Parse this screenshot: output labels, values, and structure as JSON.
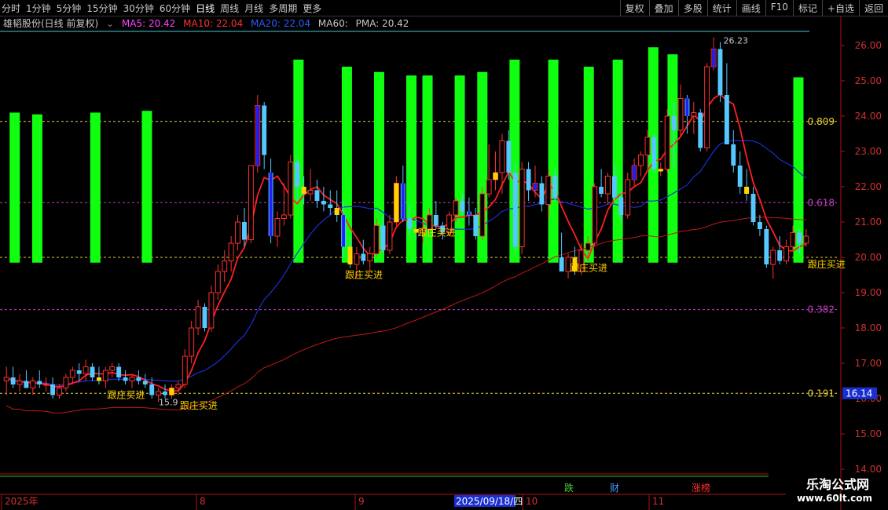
{
  "toolbar": {
    "periods": [
      "分时",
      "1分钟",
      "5分钟",
      "15分钟",
      "30分钟",
      "60分钟",
      "日线",
      "周线",
      "月线",
      "多周期",
      "更多"
    ],
    "active_period": "日线",
    "right_buttons": [
      "复权",
      "叠加",
      "多股",
      "统计",
      "画线",
      "F10",
      "标记",
      "+自选",
      "返回"
    ]
  },
  "info": {
    "title": "雄韬股份(日线 前复权)",
    "ma5": "MA5: 20.42",
    "ma10": "MA10: 22.04",
    "ma20": "MA20: 22.04",
    "ma60": "MA60:",
    "pma": "PMA: 20.42"
  },
  "colors": {
    "up": "#ff3030",
    "down": "#55c8ff",
    "green_bar": "#10ff10",
    "yellow": "#ffd200",
    "blue": "#2020ff",
    "ma_red": "#ff2020",
    "ma_dark_red": "#c01818",
    "ma_blue": "#1a2fd0",
    "fib_yellow": "#e6d23c",
    "fib_magenta": "#c040c0",
    "axis": "#b01010",
    "cyan_line": "#40c8d8"
  },
  "watermark": {
    "line1": "乐淘公式网",
    "line2": "www.60lt.com"
  },
  "chart_data": {
    "type": "candlestick",
    "ylim": [
      14.0,
      26.4
    ],
    "y_ticks": [
      "26.00",
      "25.00",
      "24.00",
      "23.00",
      "22.00",
      "21.00",
      "20.00",
      "19.00",
      "18.00",
      "17.00",
      "16.00",
      "15.00",
      "14.00"
    ],
    "last_price_label": "16.14",
    "fib_levels": [
      {
        "label": "0.809",
        "price": 23.85
      },
      {
        "label": "0.618",
        "price": 21.55
      },
      {
        "label": "",
        "price": 20.0
      },
      {
        "label": "0.382",
        "price": 18.52
      },
      {
        "label": "0.191",
        "price": 16.15
      }
    ],
    "high_label": "26.23",
    "low_label": "15.9",
    "x_labels": [
      "2025年",
      "8",
      "9",
      "2025/09/18/四",
      "10",
      "11"
    ],
    "markers": [
      "跌",
      "财",
      "涨榜"
    ],
    "green_bar_top_prices": [
      24.1,
      24.05,
      24.1,
      24.15,
      25.6,
      25.4,
      25.25,
      25.15,
      25.15,
      25.15,
      25.25,
      25.6,
      25.6,
      25.4,
      25.6,
      25.95,
      25.75,
      25.1
    ],
    "buy_signals": [
      "跟庄买进",
      "跟庄买进",
      "跟庄买进",
      "跟庄买进",
      "跟庄买进",
      "跟庄买进"
    ],
    "candles": [
      {
        "o": 16.5,
        "h": 16.9,
        "l": 16.1,
        "c": 16.6
      },
      {
        "o": 16.6,
        "h": 16.9,
        "l": 16.3,
        "c": 16.4
      },
      {
        "o": 16.4,
        "h": 16.7,
        "l": 16.2,
        "c": 16.5
      },
      {
        "o": 16.5,
        "h": 16.8,
        "l": 16.3,
        "c": 16.3
      },
      {
        "o": 16.3,
        "h": 16.6,
        "l": 16.1,
        "c": 16.5
      },
      {
        "o": 16.5,
        "h": 16.8,
        "l": 16.3,
        "c": 16.4
      },
      {
        "o": 16.4,
        "h": 16.6,
        "l": 16.2,
        "c": 16.4
      },
      {
        "o": 16.4,
        "h": 16.6,
        "l": 16.0,
        "c": 16.1
      },
      {
        "o": 16.1,
        "h": 16.4,
        "l": 16.0,
        "c": 16.3
      },
      {
        "o": 16.3,
        "h": 16.7,
        "l": 16.2,
        "c": 16.6
      },
      {
        "o": 16.6,
        "h": 16.9,
        "l": 16.4,
        "c": 16.8
      },
      {
        "o": 16.8,
        "h": 17.0,
        "l": 16.5,
        "c": 16.7
      },
      {
        "o": 16.7,
        "h": 17.1,
        "l": 16.5,
        "c": 16.9
      },
      {
        "o": 16.9,
        "h": 17.0,
        "l": 16.5,
        "c": 16.6
      },
      {
        "o": 16.6,
        "h": 16.9,
        "l": 16.4,
        "c": 16.5
      },
      {
        "o": 16.5,
        "h": 16.9,
        "l": 16.3,
        "c": 16.8
      },
      {
        "o": 16.8,
        "h": 17.0,
        "l": 16.6,
        "c": 16.9
      },
      {
        "o": 16.9,
        "h": 17.0,
        "l": 16.5,
        "c": 16.6
      },
      {
        "o": 16.6,
        "h": 16.8,
        "l": 16.4,
        "c": 16.5
      },
      {
        "o": 16.5,
        "h": 16.7,
        "l": 16.3,
        "c": 16.6
      },
      {
        "o": 16.6,
        "h": 16.8,
        "l": 16.4,
        "c": 16.5
      },
      {
        "o": 16.5,
        "h": 16.7,
        "l": 16.3,
        "c": 16.4
      },
      {
        "o": 16.4,
        "h": 16.6,
        "l": 16.0,
        "c": 16.1
      },
      {
        "o": 16.1,
        "h": 16.3,
        "l": 15.9,
        "c": 16.2
      },
      {
        "o": 16.2,
        "h": 16.4,
        "l": 16.0,
        "c": 16.1
      },
      {
        "o": 16.1,
        "h": 16.4,
        "l": 16.0,
        "c": 16.3
      },
      {
        "o": 16.3,
        "h": 16.5,
        "l": 16.1,
        "c": 16.4
      },
      {
        "o": 16.4,
        "h": 17.4,
        "l": 16.3,
        "c": 17.2
      },
      {
        "o": 17.2,
        "h": 18.2,
        "l": 17.0,
        "c": 18.0
      },
      {
        "o": 18.0,
        "h": 18.8,
        "l": 17.8,
        "c": 18.6
      },
      {
        "o": 18.6,
        "h": 18.7,
        "l": 17.9,
        "c": 18.0
      },
      {
        "o": 18.0,
        "h": 19.2,
        "l": 17.9,
        "c": 19.0
      },
      {
        "o": 19.0,
        "h": 19.8,
        "l": 18.8,
        "c": 19.6
      },
      {
        "o": 19.6,
        "h": 20.2,
        "l": 19.3,
        "c": 19.9
      },
      {
        "o": 19.9,
        "h": 20.6,
        "l": 19.6,
        "c": 20.4
      },
      {
        "o": 20.4,
        "h": 21.2,
        "l": 20.2,
        "c": 21.0
      },
      {
        "o": 21.0,
        "h": 21.4,
        "l": 20.3,
        "c": 20.5
      },
      {
        "o": 20.5,
        "h": 22.6,
        "l": 20.4,
        "c": 22.6
      },
      {
        "o": 22.6,
        "h": 24.6,
        "l": 22.4,
        "c": 24.3
      },
      {
        "o": 24.3,
        "h": 24.4,
        "l": 22.5,
        "c": 22.9
      },
      {
        "o": 22.4,
        "h": 22.8,
        "l": 20.4,
        "c": 20.6
      },
      {
        "o": 20.6,
        "h": 21.3,
        "l": 20.3,
        "c": 21.1
      },
      {
        "o": 21.1,
        "h": 22.1,
        "l": 20.9,
        "c": 21.2
      },
      {
        "o": 21.2,
        "h": 22.9,
        "l": 21.1,
        "c": 22.7
      },
      {
        "o": 22.7,
        "h": 22.8,
        "l": 21.6,
        "c": 22.0
      },
      {
        "o": 22.0,
        "h": 22.3,
        "l": 21.5,
        "c": 21.8
      },
      {
        "o": 21.8,
        "h": 22.5,
        "l": 21.6,
        "c": 21.9
      },
      {
        "o": 21.9,
        "h": 22.2,
        "l": 21.4,
        "c": 21.6
      },
      {
        "o": 21.6,
        "h": 22.0,
        "l": 21.3,
        "c": 21.5
      },
      {
        "o": 21.5,
        "h": 21.9,
        "l": 21.2,
        "c": 21.4
      },
      {
        "o": 21.4,
        "h": 21.9,
        "l": 21.0,
        "c": 21.2
      },
      {
        "o": 21.2,
        "h": 21.6,
        "l": 20.0,
        "c": 20.3
      },
      {
        "o": 20.3,
        "h": 20.6,
        "l": 19.7,
        "c": 19.8
      },
      {
        "o": 19.8,
        "h": 20.3,
        "l": 19.4,
        "c": 20.1
      },
      {
        "o": 20.1,
        "h": 20.5,
        "l": 19.8,
        "c": 19.9
      },
      {
        "o": 19.9,
        "h": 20.3,
        "l": 19.6,
        "c": 20.1
      },
      {
        "o": 20.1,
        "h": 21.1,
        "l": 20.0,
        "c": 20.9
      },
      {
        "o": 20.9,
        "h": 21.2,
        "l": 20.1,
        "c": 20.2
      },
      {
        "o": 20.2,
        "h": 21.2,
        "l": 20.1,
        "c": 21.0
      },
      {
        "o": 21.0,
        "h": 22.3,
        "l": 20.9,
        "c": 22.1
      },
      {
        "o": 22.1,
        "h": 22.6,
        "l": 21.0,
        "c": 21.1
      },
      {
        "o": 21.1,
        "h": 21.5,
        "l": 20.6,
        "c": 20.8
      },
      {
        "o": 20.8,
        "h": 21.1,
        "l": 20.5,
        "c": 20.7
      },
      {
        "o": 20.7,
        "h": 21.0,
        "l": 20.4,
        "c": 20.8
      },
      {
        "o": 20.8,
        "h": 21.4,
        "l": 20.7,
        "c": 21.2
      },
      {
        "o": 21.2,
        "h": 21.6,
        "l": 20.8,
        "c": 20.9
      },
      {
        "o": 20.9,
        "h": 21.0,
        "l": 20.5,
        "c": 20.7
      },
      {
        "o": 20.7,
        "h": 21.3,
        "l": 20.6,
        "c": 21.2
      },
      {
        "o": 21.2,
        "h": 21.7,
        "l": 21.0,
        "c": 21.6
      },
      {
        "o": 21.6,
        "h": 21.8,
        "l": 21.2,
        "c": 21.3
      },
      {
        "o": 21.3,
        "h": 21.7,
        "l": 20.9,
        "c": 21.2
      },
      {
        "o": 21.2,
        "h": 21.4,
        "l": 20.5,
        "c": 20.6
      },
      {
        "o": 20.6,
        "h": 22.0,
        "l": 20.5,
        "c": 21.8
      },
      {
        "o": 21.8,
        "h": 23.2,
        "l": 21.7,
        "c": 22.2
      },
      {
        "o": 22.2,
        "h": 23.0,
        "l": 21.9,
        "c": 22.4
      },
      {
        "o": 22.4,
        "h": 23.5,
        "l": 21.8,
        "c": 23.3
      },
      {
        "o": 23.3,
        "h": 23.6,
        "l": 22.2,
        "c": 22.4
      },
      {
        "o": 22.4,
        "h": 22.7,
        "l": 20.1,
        "c": 20.3
      },
      {
        "o": 20.3,
        "h": 22.7,
        "l": 20.1,
        "c": 22.5
      },
      {
        "o": 22.5,
        "h": 22.7,
        "l": 21.6,
        "c": 21.9
      },
      {
        "o": 21.9,
        "h": 22.6,
        "l": 21.7,
        "c": 22.1
      },
      {
        "o": 22.1,
        "h": 22.3,
        "l": 21.3,
        "c": 21.5
      },
      {
        "o": 21.5,
        "h": 22.5,
        "l": 21.1,
        "c": 22.3
      },
      {
        "o": 22.3,
        "h": 22.5,
        "l": 21.6,
        "c": 21.7
      },
      {
        "o": 20.0,
        "h": 20.7,
        "l": 19.6,
        "c": 19.6
      },
      {
        "o": 19.6,
        "h": 20.1,
        "l": 19.4,
        "c": 20.0
      },
      {
        "o": 20.0,
        "h": 20.3,
        "l": 19.5,
        "c": 19.6
      },
      {
        "o": 19.6,
        "h": 20.4,
        "l": 19.5,
        "c": 20.2
      },
      {
        "o": 20.2,
        "h": 20.6,
        "l": 19.9,
        "c": 20.4
      },
      {
        "o": 20.4,
        "h": 22.1,
        "l": 20.3,
        "c": 22.0
      },
      {
        "o": 22.0,
        "h": 22.5,
        "l": 21.7,
        "c": 21.8
      },
      {
        "o": 21.8,
        "h": 22.4,
        "l": 21.5,
        "c": 22.3
      },
      {
        "o": 22.3,
        "h": 22.6,
        "l": 21.6,
        "c": 21.7
      },
      {
        "o": 21.7,
        "h": 21.9,
        "l": 21.0,
        "c": 21.2
      },
      {
        "o": 21.2,
        "h": 22.4,
        "l": 21.1,
        "c": 22.2
      },
      {
        "o": 22.2,
        "h": 22.8,
        "l": 22.0,
        "c": 22.6
      },
      {
        "o": 22.6,
        "h": 23.0,
        "l": 22.3,
        "c": 22.9
      },
      {
        "o": 22.9,
        "h": 23.6,
        "l": 22.5,
        "c": 23.4
      },
      {
        "o": 23.4,
        "h": 23.5,
        "l": 22.4,
        "c": 22.5
      },
      {
        "o": 22.5,
        "h": 22.7,
        "l": 22.3,
        "c": 22.5
      },
      {
        "o": 22.5,
        "h": 24.2,
        "l": 22.4,
        "c": 24.0
      },
      {
        "o": 24.0,
        "h": 24.4,
        "l": 22.5,
        "c": 23.6
      },
      {
        "o": 23.6,
        "h": 24.9,
        "l": 23.4,
        "c": 24.5
      },
      {
        "o": 24.5,
        "h": 24.6,
        "l": 23.5,
        "c": 24.0
      },
      {
        "o": 24.0,
        "h": 24.4,
        "l": 23.5,
        "c": 24.1
      },
      {
        "o": 24.1,
        "h": 24.2,
        "l": 23.0,
        "c": 23.1
      },
      {
        "o": 23.1,
        "h": 25.5,
        "l": 23.0,
        "c": 25.4
      },
      {
        "o": 25.4,
        "h": 26.23,
        "l": 25.3,
        "c": 25.9
      },
      {
        "o": 25.9,
        "h": 26.1,
        "l": 24.4,
        "c": 24.6
      },
      {
        "o": 24.6,
        "h": 25.5,
        "l": 23.6,
        "c": 23.2
      },
      {
        "o": 23.2,
        "h": 23.6,
        "l": 22.4,
        "c": 22.6
      },
      {
        "o": 22.6,
        "h": 23.0,
        "l": 21.8,
        "c": 22.0
      },
      {
        "o": 22.0,
        "h": 22.5,
        "l": 21.6,
        "c": 21.8
      },
      {
        "o": 21.8,
        "h": 22.0,
        "l": 20.9,
        "c": 21.0
      },
      {
        "o": 21.0,
        "h": 21.2,
        "l": 20.6,
        "c": 20.8
      },
      {
        "o": 20.8,
        "h": 20.9,
        "l": 19.7,
        "c": 19.8
      },
      {
        "o": 19.8,
        "h": 20.3,
        "l": 19.4,
        "c": 20.2
      },
      {
        "o": 20.2,
        "h": 20.6,
        "l": 19.8,
        "c": 19.9
      },
      {
        "o": 19.9,
        "h": 20.5,
        "l": 19.8,
        "c": 20.3
      },
      {
        "o": 20.3,
        "h": 20.9,
        "l": 20.2,
        "c": 20.7
      },
      {
        "o": 20.7,
        "h": 20.8,
        "l": 20.1,
        "c": 20.4
      },
      {
        "o": 20.4,
        "h": 20.8,
        "l": 20.3,
        "c": 20.6
      }
    ]
  }
}
